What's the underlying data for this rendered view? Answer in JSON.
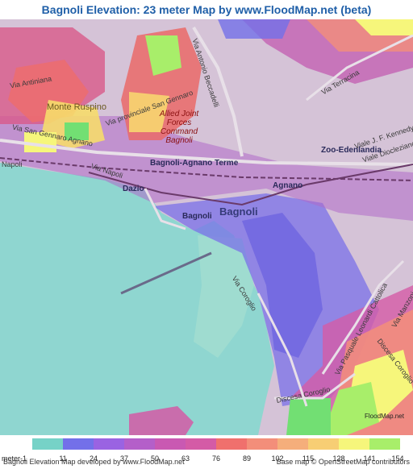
{
  "title": "Bagnoli Elevation: 23 meter Map by www.FloodMap.net (beta)",
  "map": {
    "streets": [
      "Via Antiniana",
      "Via Antonio Beccadelli",
      "Via Terracina",
      "Via provinciale San Gennaro",
      "Via San Gennaro Agnano",
      "Viale J. F. Kennedy",
      "Viale Diocleziano",
      "Via Napoli",
      "Via Coroglio",
      "Via Pasquale Leonardi Cattolica",
      "Discesa Coroglio",
      "Via Manzoni"
    ],
    "places": {
      "monte": "Monte Ruspino",
      "military": "Allied Joint Forces Command Bagnoli",
      "station": "Bagnoli-Agnano Terme",
      "zoo": "Zoo-Edenlandia",
      "agnano": "Agnano",
      "dazio": "Dazio",
      "bagnoli_small": "Bagnoli",
      "bagnoli_big": "Bagnoli",
      "edge_napoli": "Napoli"
    },
    "colors": {
      "sea": "#8fd6d0",
      "land": "#d7c4d8"
    }
  },
  "legend": {
    "colors": [
      "#76d2c7",
      "#7370e9",
      "#9a63e2",
      "#b45fc9",
      "#c959b2",
      "#d45ba6",
      "#f0706d",
      "#f38e7a",
      "#f5ae7b",
      "#f7ce74",
      "#f6f67b",
      "#a8ee6a",
      "#72df73"
    ],
    "values": [
      "meter-1",
      "11",
      "24",
      "37",
      "50",
      "63",
      "76",
      "89",
      "102",
      "115",
      "128",
      "141",
      "154"
    ]
  },
  "footer": {
    "left": "Bagnoli Elevation Map developed by www.FloodMap.net",
    "right": "Base map © OpenStreetMap contributors",
    "compass": "FloodMap.net"
  }
}
